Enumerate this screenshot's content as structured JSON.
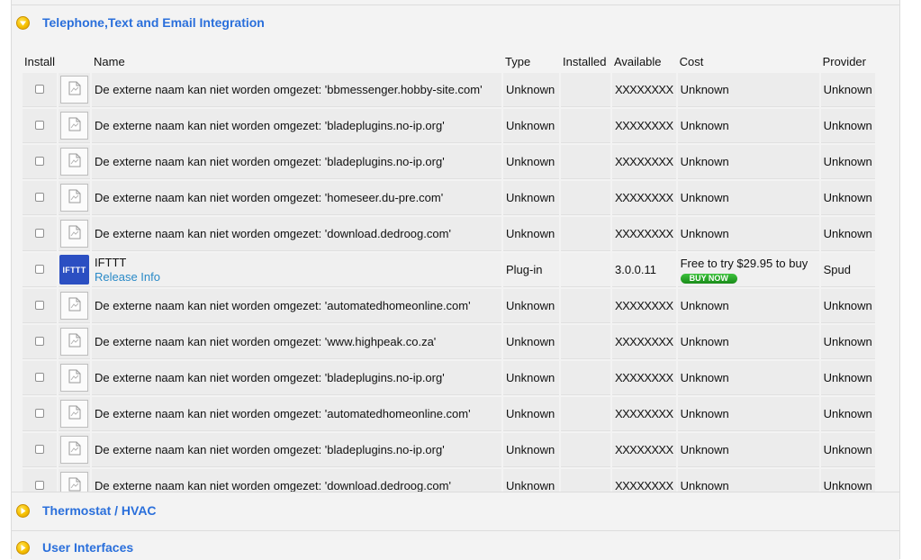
{
  "sections": {
    "telephone": {
      "title": "Telephone,Text and Email Integration",
      "expanded": true,
      "icon": "arrow-down-icon"
    },
    "thermostat": {
      "title": "Thermostat / HVAC",
      "expanded": false,
      "icon": "arrow-right-icon"
    },
    "ui": {
      "title": "User Interfaces",
      "expanded": false,
      "icon": "arrow-right-icon"
    }
  },
  "table": {
    "headers": {
      "install": "Install",
      "name": "Name",
      "type": "Type",
      "installed": "Installed",
      "available": "Available",
      "cost": "Cost",
      "provider": "Provider"
    },
    "rows": [
      {
        "name": "De externe naam kan niet worden omgezet: 'bbmessenger.hobby-site.com'",
        "type": "Unknown",
        "installed": "",
        "available": "XXXXXXXX",
        "cost": "Unknown",
        "provider": "Unknown"
      },
      {
        "name": "De externe naam kan niet worden omgezet: 'bladeplugins.no-ip.org'",
        "type": "Unknown",
        "installed": "",
        "available": "XXXXXXXX",
        "cost": "Unknown",
        "provider": "Unknown"
      },
      {
        "name": "De externe naam kan niet worden omgezet: 'bladeplugins.no-ip.org'",
        "type": "Unknown",
        "installed": "",
        "available": "XXXXXXXX",
        "cost": "Unknown",
        "provider": "Unknown"
      },
      {
        "name": "De externe naam kan niet worden omgezet: 'homeseer.du-pre.com'",
        "type": "Unknown",
        "installed": "",
        "available": "XXXXXXXX",
        "cost": "Unknown",
        "provider": "Unknown"
      },
      {
        "name": "De externe naam kan niet worden omgezet: 'download.dedroog.com'",
        "type": "Unknown",
        "installed": "",
        "available": "XXXXXXXX",
        "cost": "Unknown",
        "provider": "Unknown"
      },
      {
        "name": "IFTTT",
        "release_info": "Release Info",
        "logo_text": "IFTTT",
        "type": "Plug-in",
        "installed": "",
        "available": "3.0.0.11",
        "cost": "Free to try $29.95 to buy",
        "buy_label": "BUY NOW",
        "provider": "Spud"
      },
      {
        "name": "De externe naam kan niet worden omgezet: 'automatedhomeonline.com'",
        "type": "Unknown",
        "installed": "",
        "available": "XXXXXXXX",
        "cost": "Unknown",
        "provider": "Unknown"
      },
      {
        "name": "De externe naam kan niet worden omgezet: 'www.highpeak.co.za'",
        "type": "Unknown",
        "installed": "",
        "available": "XXXXXXXX",
        "cost": "Unknown",
        "provider": "Unknown"
      },
      {
        "name": "De externe naam kan niet worden omgezet: 'bladeplugins.no-ip.org'",
        "type": "Unknown",
        "installed": "",
        "available": "XXXXXXXX",
        "cost": "Unknown",
        "provider": "Unknown"
      },
      {
        "name": "De externe naam kan niet worden omgezet: 'automatedhomeonline.com'",
        "type": "Unknown",
        "installed": "",
        "available": "XXXXXXXX",
        "cost": "Unknown",
        "provider": "Unknown"
      },
      {
        "name": "De externe naam kan niet worden omgezet: 'bladeplugins.no-ip.org'",
        "type": "Unknown",
        "installed": "",
        "available": "XXXXXXXX",
        "cost": "Unknown",
        "provider": "Unknown"
      },
      {
        "name": "De externe naam kan niet worden omgezet: 'download.dedroog.com'",
        "type": "Unknown",
        "installed": "",
        "available": "XXXXXXXX",
        "cost": "Unknown",
        "provider": "Unknown"
      }
    ]
  },
  "colors": {
    "section_title": "#2a6fdb",
    "link": "#2a8ac7",
    "buy_button": "#1a8c1a",
    "ifttt_logo_bg": "#2b4fc2"
  }
}
